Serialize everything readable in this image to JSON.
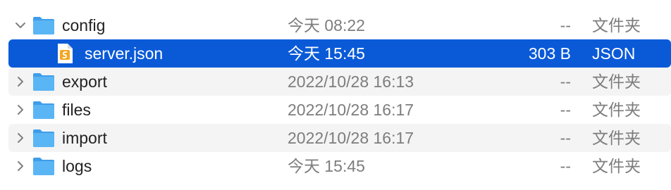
{
  "rows": [
    {
      "name": "config",
      "date": "今天 08:22",
      "size": "--",
      "kind": "文件夹",
      "type": "folder",
      "expanded": true,
      "selected": false,
      "striped": false
    },
    {
      "name": "server.json",
      "date": "今天 15:45",
      "size": "303 B",
      "kind": "JSON",
      "type": "json-file",
      "expanded": false,
      "selected": true,
      "striped": false
    },
    {
      "name": "export",
      "date": "2022/10/28 16:13",
      "size": "--",
      "kind": "文件夹",
      "type": "folder",
      "expanded": false,
      "selected": false,
      "striped": true
    },
    {
      "name": "files",
      "date": "2022/10/28 16:17",
      "size": "--",
      "kind": "文件夹",
      "type": "folder",
      "expanded": false,
      "selected": false,
      "striped": false
    },
    {
      "name": "import",
      "date": "2022/10/28 16:17",
      "size": "--",
      "kind": "文件夹",
      "type": "folder",
      "expanded": false,
      "selected": false,
      "striped": true
    },
    {
      "name": "logs",
      "date": "今天 15:45",
      "size": "--",
      "kind": "文件夹",
      "type": "folder",
      "expanded": false,
      "selected": false,
      "striped": false
    }
  ],
  "colors": {
    "selection": "#0a5ad8",
    "folder": "#4aa8f0",
    "json_badge": "#f5a623",
    "stripe": "#f4f4f4"
  }
}
